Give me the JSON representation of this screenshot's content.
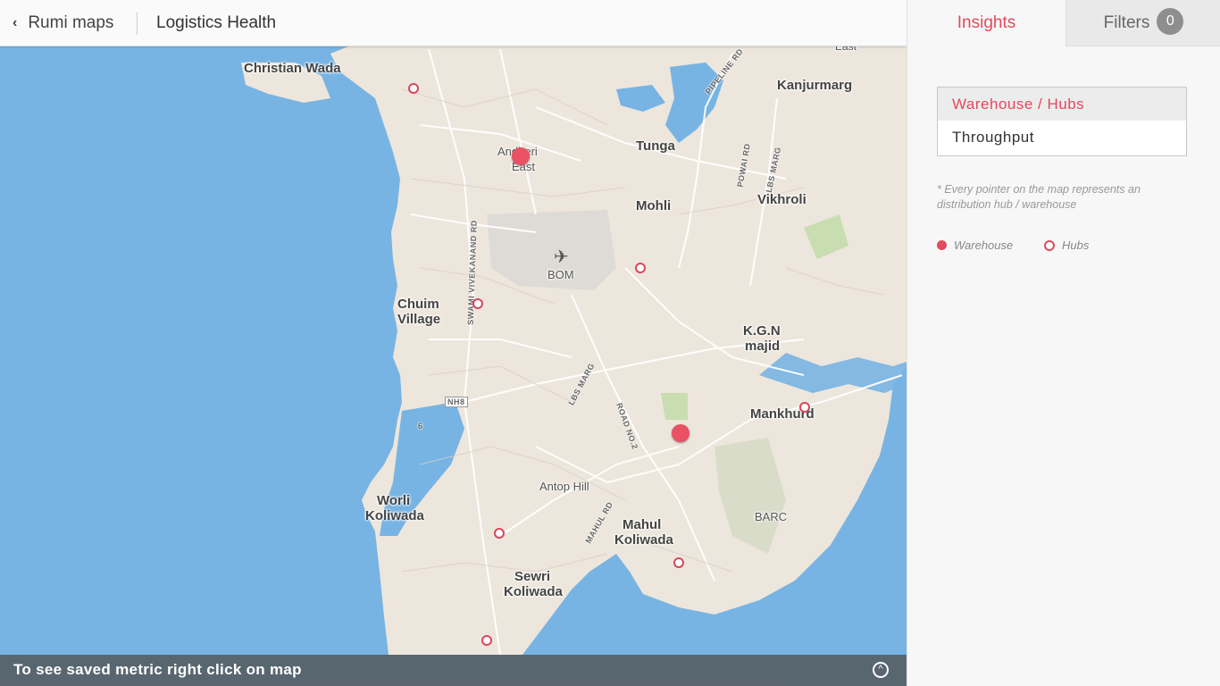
{
  "header": {
    "back_label": "Rumi maps",
    "title": "Logistics Health"
  },
  "map": {
    "places": {
      "christian_wada": "Christian Wada",
      "kanjurmarg": "Kanjurmarg",
      "andheri": "Andheri",
      "east": "East",
      "tunga": "Tunga",
      "mohli": "Mohli",
      "vikhroli": "Vikhroli",
      "bom": "BOM",
      "chuim": "Chuim",
      "village": "Village",
      "kgn": "K.G.N",
      "majid": "majid",
      "mankhurd": "Mankhurd",
      "antop_hill": "Antop Hill",
      "worli": "Worli",
      "koliwada": "Koliwada",
      "mahul": "Mahul",
      "mahul_koliwada": "Koliwada",
      "barc": "BARC",
      "sewri": "Sewri",
      "sewri_koliwada": "Koliwada",
      "east_top": "East"
    },
    "roads": {
      "pipeline": "PIPELINE RD",
      "powai": "POWAI RD",
      "lbs_marg_top": "LBS MARG",
      "swami": "SWAMI VIVEKANAND RD",
      "lbs_marg": "LBS MARG",
      "road_no2": "ROAD NO.2",
      "mahul_rd": "MAHUL RD",
      "nh8": "NH8",
      "six": "6"
    },
    "warehouses_count": 2,
    "hubs_count": 8
  },
  "bottom_bar": {
    "hint": "To see saved metric right click on map",
    "expand_icon": "chevron-up-circle-icon"
  },
  "panel": {
    "tabs": {
      "insights": "Insights",
      "filters": "Filters",
      "filter_count": "0"
    },
    "metrics": [
      {
        "label": "Warehouse / Hubs",
        "active": true
      },
      {
        "label": "Throughput",
        "active": false
      }
    ],
    "note": "* Every pointer on the map represents an distribution hub / warehouse",
    "legend": {
      "warehouse": "Warehouse",
      "hubs": "Hubs"
    }
  },
  "colors": {
    "accent": "#e24a5d",
    "water": "#77b4e3",
    "land": "#ede6dc",
    "park": "#c8ddb0"
  }
}
